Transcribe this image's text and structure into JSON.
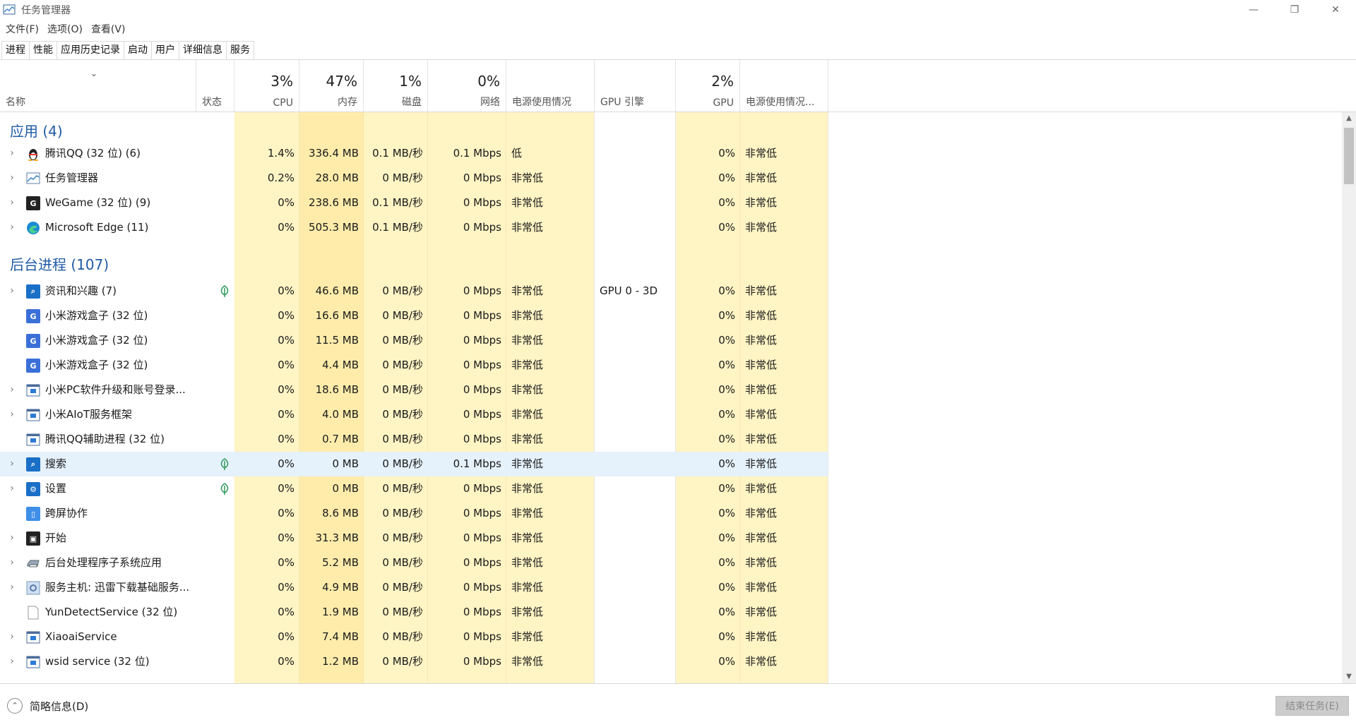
{
  "window": {
    "title": "任务管理器",
    "minimize": "—",
    "maximize": "❐",
    "close": "✕"
  },
  "menu": [
    "文件(F)",
    "选项(O)",
    "查看(V)"
  ],
  "tabs": [
    "进程",
    "性能",
    "应用历史记录",
    "启动",
    "用户",
    "详细信息",
    "服务"
  ],
  "active_tab": "进程",
  "columns": {
    "name": "名称",
    "status": "状态",
    "cpu": {
      "pct": "3%",
      "label": "CPU"
    },
    "memory": {
      "pct": "47%",
      "label": "内存"
    },
    "disk": {
      "pct": "1%",
      "label": "磁盘"
    },
    "network": {
      "pct": "0%",
      "label": "网络"
    },
    "power": {
      "label": "电源使用情况"
    },
    "gpu_engine": {
      "label": "GPU 引擎"
    },
    "gpu": {
      "pct": "2%",
      "label": "GPU"
    },
    "power_trend": {
      "label": "电源使用情况..."
    }
  },
  "groups": {
    "apps": "应用 (4)",
    "background": "后台进程 (107)"
  },
  "apps": [
    {
      "name": "腾讯QQ (32 位) (6)",
      "icon": "qq-penguin-icon",
      "cpu": "1.4%",
      "mem": "336.4 MB",
      "disk": "0.1 MB/秒",
      "net": "0.1 Mbps",
      "power": "低",
      "gpu_engine": "",
      "gpu": "0%",
      "trend": "非常低"
    },
    {
      "name": "任务管理器",
      "icon": "task-manager-icon",
      "cpu": "0.2%",
      "mem": "28.0 MB",
      "disk": "0 MB/秒",
      "net": "0 Mbps",
      "power": "非常低",
      "gpu_engine": "",
      "gpu": "0%",
      "trend": "非常低"
    },
    {
      "name": "WeGame (32 位) (9)",
      "icon": "wegame-icon",
      "cpu": "0%",
      "mem": "238.6 MB",
      "disk": "0.1 MB/秒",
      "net": "0 Mbps",
      "power": "非常低",
      "gpu_engine": "",
      "gpu": "0%",
      "trend": "非常低"
    },
    {
      "name": "Microsoft Edge (11)",
      "icon": "edge-icon",
      "cpu": "0%",
      "mem": "505.3 MB",
      "disk": "0.1 MB/秒",
      "net": "0 Mbps",
      "power": "非常低",
      "gpu_engine": "",
      "gpu": "0%",
      "trend": "非常低"
    }
  ],
  "background": [
    {
      "name": "资讯和兴趣 (7)",
      "icon": "news-icon",
      "cpu": "0%",
      "mem": "46.6 MB",
      "disk": "0 MB/秒",
      "net": "0 Mbps",
      "power": "非常低",
      "gpu_engine": "GPU 0 - 3D",
      "gpu": "0%",
      "trend": "非常低"
    },
    {
      "name": "小米游戏盒子 (32 位)",
      "icon": "mi-game-box-icon",
      "cpu": "0%",
      "mem": "16.6 MB",
      "disk": "0 MB/秒",
      "net": "0 Mbps",
      "power": "非常低",
      "gpu_engine": "",
      "gpu": "0%",
      "trend": "非常低"
    },
    {
      "name": "小米游戏盒子 (32 位)",
      "icon": "mi-game-box-icon",
      "cpu": "0%",
      "mem": "11.5 MB",
      "disk": "0 MB/秒",
      "net": "0 Mbps",
      "power": "非常低",
      "gpu_engine": "",
      "gpu": "0%",
      "trend": "非常低"
    },
    {
      "name": "小米游戏盒子 (32 位)",
      "icon": "mi-game-box-icon",
      "cpu": "0%",
      "mem": "4.4 MB",
      "disk": "0 MB/秒",
      "net": "0 Mbps",
      "power": "非常低",
      "gpu_engine": "",
      "gpu": "0%",
      "trend": "非常低"
    },
    {
      "name": "小米PC软件升级和账号登录...",
      "icon": "service-window-icon",
      "cpu": "0%",
      "mem": "18.6 MB",
      "disk": "0 MB/秒",
      "net": "0 Mbps",
      "power": "非常低",
      "gpu_engine": "",
      "gpu": "0%",
      "trend": "非常低"
    },
    {
      "name": "小米AIoT服务框架",
      "icon": "service-window-icon",
      "cpu": "0%",
      "mem": "4.0 MB",
      "disk": "0 MB/秒",
      "net": "0 Mbps",
      "power": "非常低",
      "gpu_engine": "",
      "gpu": "0%",
      "trend": "非常低"
    },
    {
      "name": "腾讯QQ辅助进程 (32 位)",
      "icon": "service-window-icon",
      "cpu": "0%",
      "mem": "0.7 MB",
      "disk": "0 MB/秒",
      "net": "0 Mbps",
      "power": "非常低",
      "gpu_engine": "",
      "gpu": "0%",
      "trend": "非常低"
    },
    {
      "name": "搜索",
      "icon": "search-icon",
      "cpu": "0%",
      "mem": "0 MB",
      "disk": "0 MB/秒",
      "net": "0.1 Mbps",
      "power": "非常低",
      "gpu_engine": "",
      "gpu": "0%",
      "trend": "非常低"
    },
    {
      "name": "设置",
      "icon": "gear-icon",
      "cpu": "0%",
      "mem": "0 MB",
      "disk": "0 MB/秒",
      "net": "0 Mbps",
      "power": "非常低",
      "gpu_engine": "",
      "gpu": "0%",
      "trend": "非常低"
    },
    {
      "name": "跨屏协作",
      "icon": "phone-icon",
      "cpu": "0%",
      "mem": "8.6 MB",
      "disk": "0 MB/秒",
      "net": "0 Mbps",
      "power": "非常低",
      "gpu_engine": "",
      "gpu": "0%",
      "trend": "非常低"
    },
    {
      "name": "开始",
      "icon": "start-icon",
      "cpu": "0%",
      "mem": "31.3 MB",
      "disk": "0 MB/秒",
      "net": "0 Mbps",
      "power": "非常低",
      "gpu_engine": "",
      "gpu": "0%",
      "trend": "非常低"
    },
    {
      "name": "后台处理程序子系统应用",
      "icon": "printer-icon",
      "cpu": "0%",
      "mem": "5.2 MB",
      "disk": "0 MB/秒",
      "net": "0 Mbps",
      "power": "非常低",
      "gpu_engine": "",
      "gpu": "0%",
      "trend": "非常低"
    },
    {
      "name": "服务主机: 迅雷下载基础服务...",
      "icon": "service-host-icon",
      "cpu": "0%",
      "mem": "4.9 MB",
      "disk": "0 MB/秒",
      "net": "0 Mbps",
      "power": "非常低",
      "gpu_engine": "",
      "gpu": "0%",
      "trend": "非常低"
    },
    {
      "name": "YunDetectService (32 位)",
      "icon": "file-icon",
      "cpu": "0%",
      "mem": "1.9 MB",
      "disk": "0 MB/秒",
      "net": "0 Mbps",
      "power": "非常低",
      "gpu_engine": "",
      "gpu": "0%",
      "trend": "非常低"
    },
    {
      "name": "XiaoaiService",
      "icon": "service-window-icon",
      "cpu": "0%",
      "mem": "7.4 MB",
      "disk": "0 MB/秒",
      "net": "0 Mbps",
      "power": "非常低",
      "gpu_engine": "",
      "gpu": "0%",
      "trend": "非常低"
    },
    {
      "name": "wsid service (32 位)",
      "icon": "service-window-icon",
      "cpu": "0%",
      "mem": "1.2 MB",
      "disk": "0 MB/秒",
      "net": "0 Mbps",
      "power": "非常低",
      "gpu_engine": "",
      "gpu": "0%",
      "trend": "非常低"
    }
  ],
  "footer": {
    "brief": "简略信息(D)",
    "end_task": "结束任务(E)"
  },
  "colors": {
    "heat_light": "#fff4c4",
    "heat_med": "#ffecab",
    "group_title": "#1f5aa6",
    "selected_row": "#e5f1fb"
  }
}
